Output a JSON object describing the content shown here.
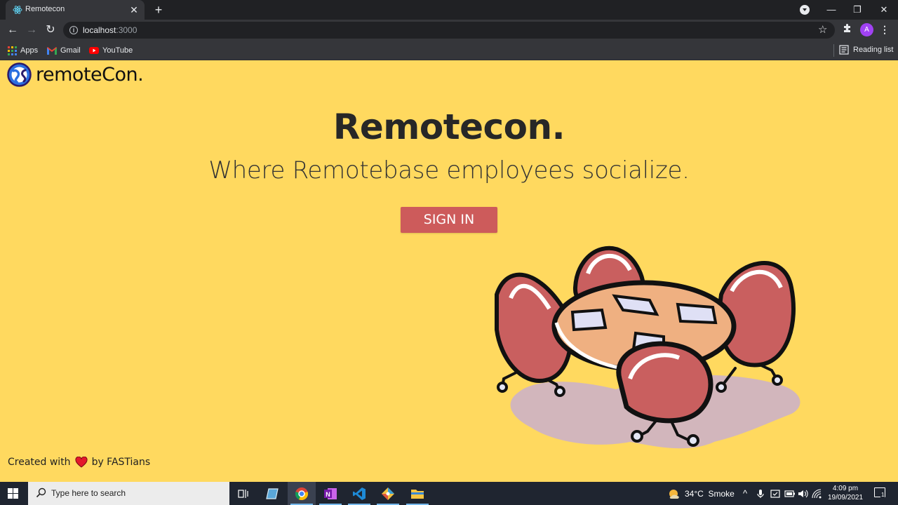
{
  "browser": {
    "tab_title": "Remotecon",
    "url_host": "localhost",
    "url_port": ":3000",
    "avatar_letter": "A",
    "bookmarks": [
      {
        "label": "Apps",
        "icon": "apps-grid-icon"
      },
      {
        "label": "Gmail",
        "icon": "gmail-icon"
      },
      {
        "label": "YouTube",
        "icon": "youtube-icon"
      }
    ],
    "reading_list_label": "Reading list"
  },
  "page": {
    "logo_text": "remoteCon.",
    "title": "Remotecon.",
    "subtitle": "Where Remotebase employees socialize.",
    "signin_label": "SIGN IN",
    "footer_prefix": "Created with",
    "footer_suffix": "by FASTians",
    "accent_color": "#ffd95f",
    "button_color": "#cd5b5b"
  },
  "taskbar": {
    "search_placeholder": "Type here to search",
    "weather": "34°C  Smoke",
    "time": "4:09 pm",
    "date": "19/09/2021",
    "notification_count": "1"
  }
}
